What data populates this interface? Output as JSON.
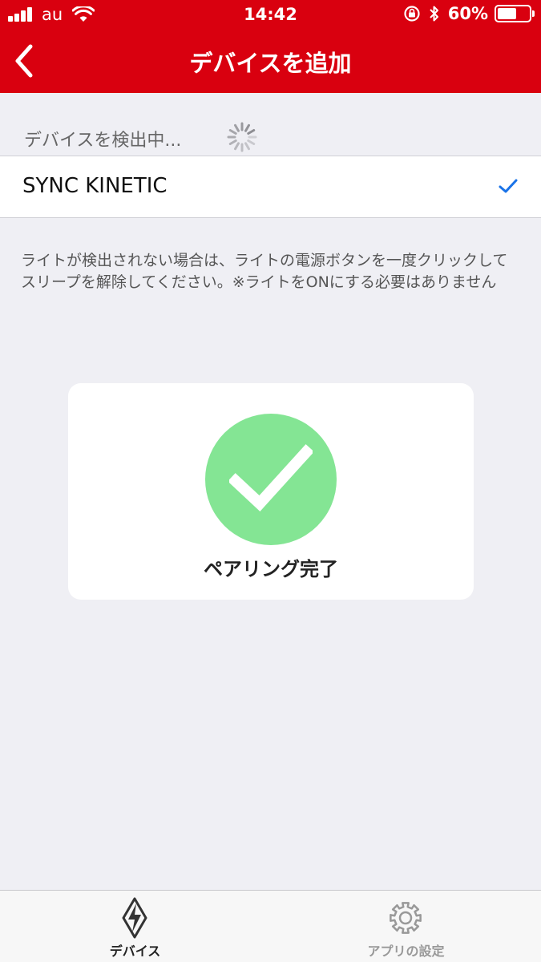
{
  "status_bar": {
    "carrier": "au",
    "time": "14:42",
    "battery": "60%",
    "battery_level": 0.6
  },
  "nav": {
    "title": "デバイスを追加"
  },
  "scan": {
    "status_label": "デバイスを検出中..."
  },
  "device_list": [
    {
      "name": "SYNC KINETIC",
      "selected": true
    }
  ],
  "hint": {
    "text": "ライトが検出されない場合は、ライトの電源ボタンを一度クリックしてスリープを解除してください。※ライトをONにする必要はありません"
  },
  "result": {
    "label": "ペアリング完了"
  },
  "tab_bar": {
    "tabs": [
      {
        "label": "デバイス",
        "active": true
      },
      {
        "label": "アプリの設定",
        "active": false
      }
    ]
  },
  "colors": {
    "header_red": "#d9000f",
    "success_green": "#84e594",
    "check_blue": "#1a73e8",
    "background": "#efeff4"
  },
  "icons": {
    "back": "chevron-left-icon",
    "spinner": "loading-spinner-icon",
    "check": "checkmark-icon",
    "devices": "device-logo-icon",
    "settings": "gear-icon"
  }
}
